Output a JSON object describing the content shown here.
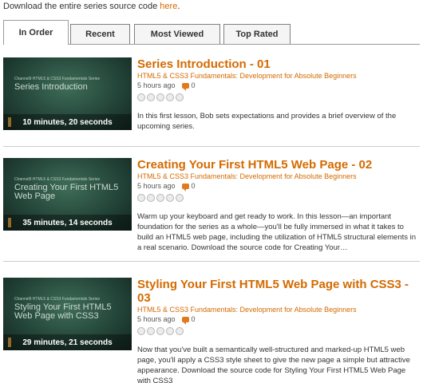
{
  "download": {
    "prefix": "Download the entire series source code",
    "link": "here",
    "suffix": "."
  },
  "tabs": [
    {
      "label": "In Order",
      "active": true
    },
    {
      "label": "Recent",
      "active": false
    },
    {
      "label": "Most Viewed",
      "active": false
    },
    {
      "label": "Top Rated",
      "active": false
    }
  ],
  "episodes": [
    {
      "thumb_series": "Channel9 HTML5 & CSS3 Fundamentals Series",
      "thumb_title": "Series Introduction",
      "duration": "10 minutes, 20 seconds",
      "title": "Series Introduction - 01",
      "series": "HTML5 & CSS3 Fundamentals: Development for Absolute Beginners",
      "posted": "5 hours ago",
      "comments": "0",
      "rating": 0,
      "description": "In this first lesson, Bob sets expectations and provides a brief overview of the upcoming series."
    },
    {
      "thumb_series": "Channel9 HTML5 & CSS3 Fundamentals Series",
      "thumb_title": "Creating Your First HTML5 Web Page",
      "duration": "35 minutes, 14 seconds",
      "title": "Creating Your First HTML5 Web Page - 02",
      "series": "HTML5 & CSS3 Fundamentals: Development for Absolute Beginners",
      "posted": "5 hours ago",
      "comments": "0",
      "rating": 0,
      "description": "Warm up your keyboard and get ready to work. In this lesson—an important foundation for the series as a whole—you'll be fully immersed in what it takes to build an HTML5 web page, including the utilization of HTML5 structural elements in a real scenario. Download the source code for Creating Your…"
    },
    {
      "thumb_series": "Channel9 HTML5 & CSS3 Fundamentals Series",
      "thumb_title": "Styling Your First HTML5 Web Page with CSS3",
      "duration": "29 minutes, 21 seconds",
      "title": "Styling Your First HTML5 Web Page with CSS3 - 03",
      "series": "HTML5 & CSS3 Fundamentals: Development for Absolute Beginners",
      "posted": "5 hours ago",
      "comments": "0",
      "rating": 0,
      "description": "Now that you've built a semantically well-structured and marked-up HTML5 web page, you'll apply a CSS3 style sheet to give the new page a simple but attractive appearance.  Download the source code for Styling Your First HTML5 Web Page with CSS3"
    }
  ],
  "colors": {
    "accent": "#d46a00",
    "comment_icon": "#e07a1f",
    "thumb_bg": "#2c5444"
  }
}
